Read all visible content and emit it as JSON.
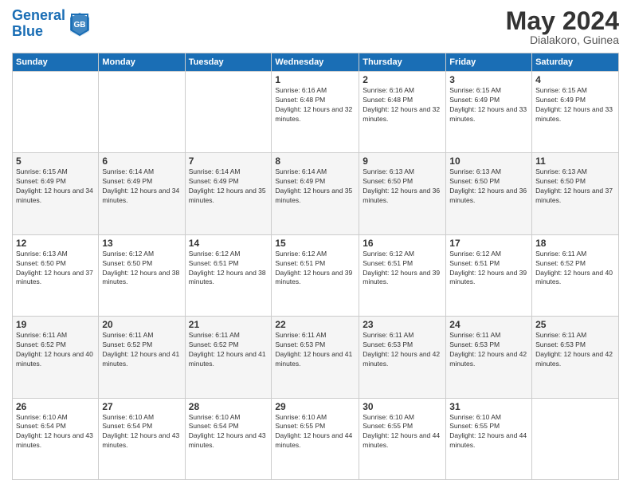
{
  "header": {
    "logo_line1": "General",
    "logo_line2": "Blue",
    "month": "May 2024",
    "location": "Dialakoro, Guinea"
  },
  "weekdays": [
    "Sunday",
    "Monday",
    "Tuesday",
    "Wednesday",
    "Thursday",
    "Friday",
    "Saturday"
  ],
  "weeks": [
    [
      {
        "day": "",
        "sunrise": "",
        "sunset": "",
        "daylight": ""
      },
      {
        "day": "",
        "sunrise": "",
        "sunset": "",
        "daylight": ""
      },
      {
        "day": "",
        "sunrise": "",
        "sunset": "",
        "daylight": ""
      },
      {
        "day": "1",
        "sunrise": "Sunrise: 6:16 AM",
        "sunset": "Sunset: 6:48 PM",
        "daylight": "Daylight: 12 hours and 32 minutes."
      },
      {
        "day": "2",
        "sunrise": "Sunrise: 6:16 AM",
        "sunset": "Sunset: 6:48 PM",
        "daylight": "Daylight: 12 hours and 32 minutes."
      },
      {
        "day": "3",
        "sunrise": "Sunrise: 6:15 AM",
        "sunset": "Sunset: 6:49 PM",
        "daylight": "Daylight: 12 hours and 33 minutes."
      },
      {
        "day": "4",
        "sunrise": "Sunrise: 6:15 AM",
        "sunset": "Sunset: 6:49 PM",
        "daylight": "Daylight: 12 hours and 33 minutes."
      }
    ],
    [
      {
        "day": "5",
        "sunrise": "Sunrise: 6:15 AM",
        "sunset": "Sunset: 6:49 PM",
        "daylight": "Daylight: 12 hours and 34 minutes."
      },
      {
        "day": "6",
        "sunrise": "Sunrise: 6:14 AM",
        "sunset": "Sunset: 6:49 PM",
        "daylight": "Daylight: 12 hours and 34 minutes."
      },
      {
        "day": "7",
        "sunrise": "Sunrise: 6:14 AM",
        "sunset": "Sunset: 6:49 PM",
        "daylight": "Daylight: 12 hours and 35 minutes."
      },
      {
        "day": "8",
        "sunrise": "Sunrise: 6:14 AM",
        "sunset": "Sunset: 6:49 PM",
        "daylight": "Daylight: 12 hours and 35 minutes."
      },
      {
        "day": "9",
        "sunrise": "Sunrise: 6:13 AM",
        "sunset": "Sunset: 6:50 PM",
        "daylight": "Daylight: 12 hours and 36 minutes."
      },
      {
        "day": "10",
        "sunrise": "Sunrise: 6:13 AM",
        "sunset": "Sunset: 6:50 PM",
        "daylight": "Daylight: 12 hours and 36 minutes."
      },
      {
        "day": "11",
        "sunrise": "Sunrise: 6:13 AM",
        "sunset": "Sunset: 6:50 PM",
        "daylight": "Daylight: 12 hours and 37 minutes."
      }
    ],
    [
      {
        "day": "12",
        "sunrise": "Sunrise: 6:13 AM",
        "sunset": "Sunset: 6:50 PM",
        "daylight": "Daylight: 12 hours and 37 minutes."
      },
      {
        "day": "13",
        "sunrise": "Sunrise: 6:12 AM",
        "sunset": "Sunset: 6:50 PM",
        "daylight": "Daylight: 12 hours and 38 minutes."
      },
      {
        "day": "14",
        "sunrise": "Sunrise: 6:12 AM",
        "sunset": "Sunset: 6:51 PM",
        "daylight": "Daylight: 12 hours and 38 minutes."
      },
      {
        "day": "15",
        "sunrise": "Sunrise: 6:12 AM",
        "sunset": "Sunset: 6:51 PM",
        "daylight": "Daylight: 12 hours and 39 minutes."
      },
      {
        "day": "16",
        "sunrise": "Sunrise: 6:12 AM",
        "sunset": "Sunset: 6:51 PM",
        "daylight": "Daylight: 12 hours and 39 minutes."
      },
      {
        "day": "17",
        "sunrise": "Sunrise: 6:12 AM",
        "sunset": "Sunset: 6:51 PM",
        "daylight": "Daylight: 12 hours and 39 minutes."
      },
      {
        "day": "18",
        "sunrise": "Sunrise: 6:11 AM",
        "sunset": "Sunset: 6:52 PM",
        "daylight": "Daylight: 12 hours and 40 minutes."
      }
    ],
    [
      {
        "day": "19",
        "sunrise": "Sunrise: 6:11 AM",
        "sunset": "Sunset: 6:52 PM",
        "daylight": "Daylight: 12 hours and 40 minutes."
      },
      {
        "day": "20",
        "sunrise": "Sunrise: 6:11 AM",
        "sunset": "Sunset: 6:52 PM",
        "daylight": "Daylight: 12 hours and 41 minutes."
      },
      {
        "day": "21",
        "sunrise": "Sunrise: 6:11 AM",
        "sunset": "Sunset: 6:52 PM",
        "daylight": "Daylight: 12 hours and 41 minutes."
      },
      {
        "day": "22",
        "sunrise": "Sunrise: 6:11 AM",
        "sunset": "Sunset: 6:53 PM",
        "daylight": "Daylight: 12 hours and 41 minutes."
      },
      {
        "day": "23",
        "sunrise": "Sunrise: 6:11 AM",
        "sunset": "Sunset: 6:53 PM",
        "daylight": "Daylight: 12 hours and 42 minutes."
      },
      {
        "day": "24",
        "sunrise": "Sunrise: 6:11 AM",
        "sunset": "Sunset: 6:53 PM",
        "daylight": "Daylight: 12 hours and 42 minutes."
      },
      {
        "day": "25",
        "sunrise": "Sunrise: 6:11 AM",
        "sunset": "Sunset: 6:53 PM",
        "daylight": "Daylight: 12 hours and 42 minutes."
      }
    ],
    [
      {
        "day": "26",
        "sunrise": "Sunrise: 6:10 AM",
        "sunset": "Sunset: 6:54 PM",
        "daylight": "Daylight: 12 hours and 43 minutes."
      },
      {
        "day": "27",
        "sunrise": "Sunrise: 6:10 AM",
        "sunset": "Sunset: 6:54 PM",
        "daylight": "Daylight: 12 hours and 43 minutes."
      },
      {
        "day": "28",
        "sunrise": "Sunrise: 6:10 AM",
        "sunset": "Sunset: 6:54 PM",
        "daylight": "Daylight: 12 hours and 43 minutes."
      },
      {
        "day": "29",
        "sunrise": "Sunrise: 6:10 AM",
        "sunset": "Sunset: 6:55 PM",
        "daylight": "Daylight: 12 hours and 44 minutes."
      },
      {
        "day": "30",
        "sunrise": "Sunrise: 6:10 AM",
        "sunset": "Sunset: 6:55 PM",
        "daylight": "Daylight: 12 hours and 44 minutes."
      },
      {
        "day": "31",
        "sunrise": "Sunrise: 6:10 AM",
        "sunset": "Sunset: 6:55 PM",
        "daylight": "Daylight: 12 hours and 44 minutes."
      },
      {
        "day": "",
        "sunrise": "",
        "sunset": "",
        "daylight": ""
      }
    ]
  ]
}
